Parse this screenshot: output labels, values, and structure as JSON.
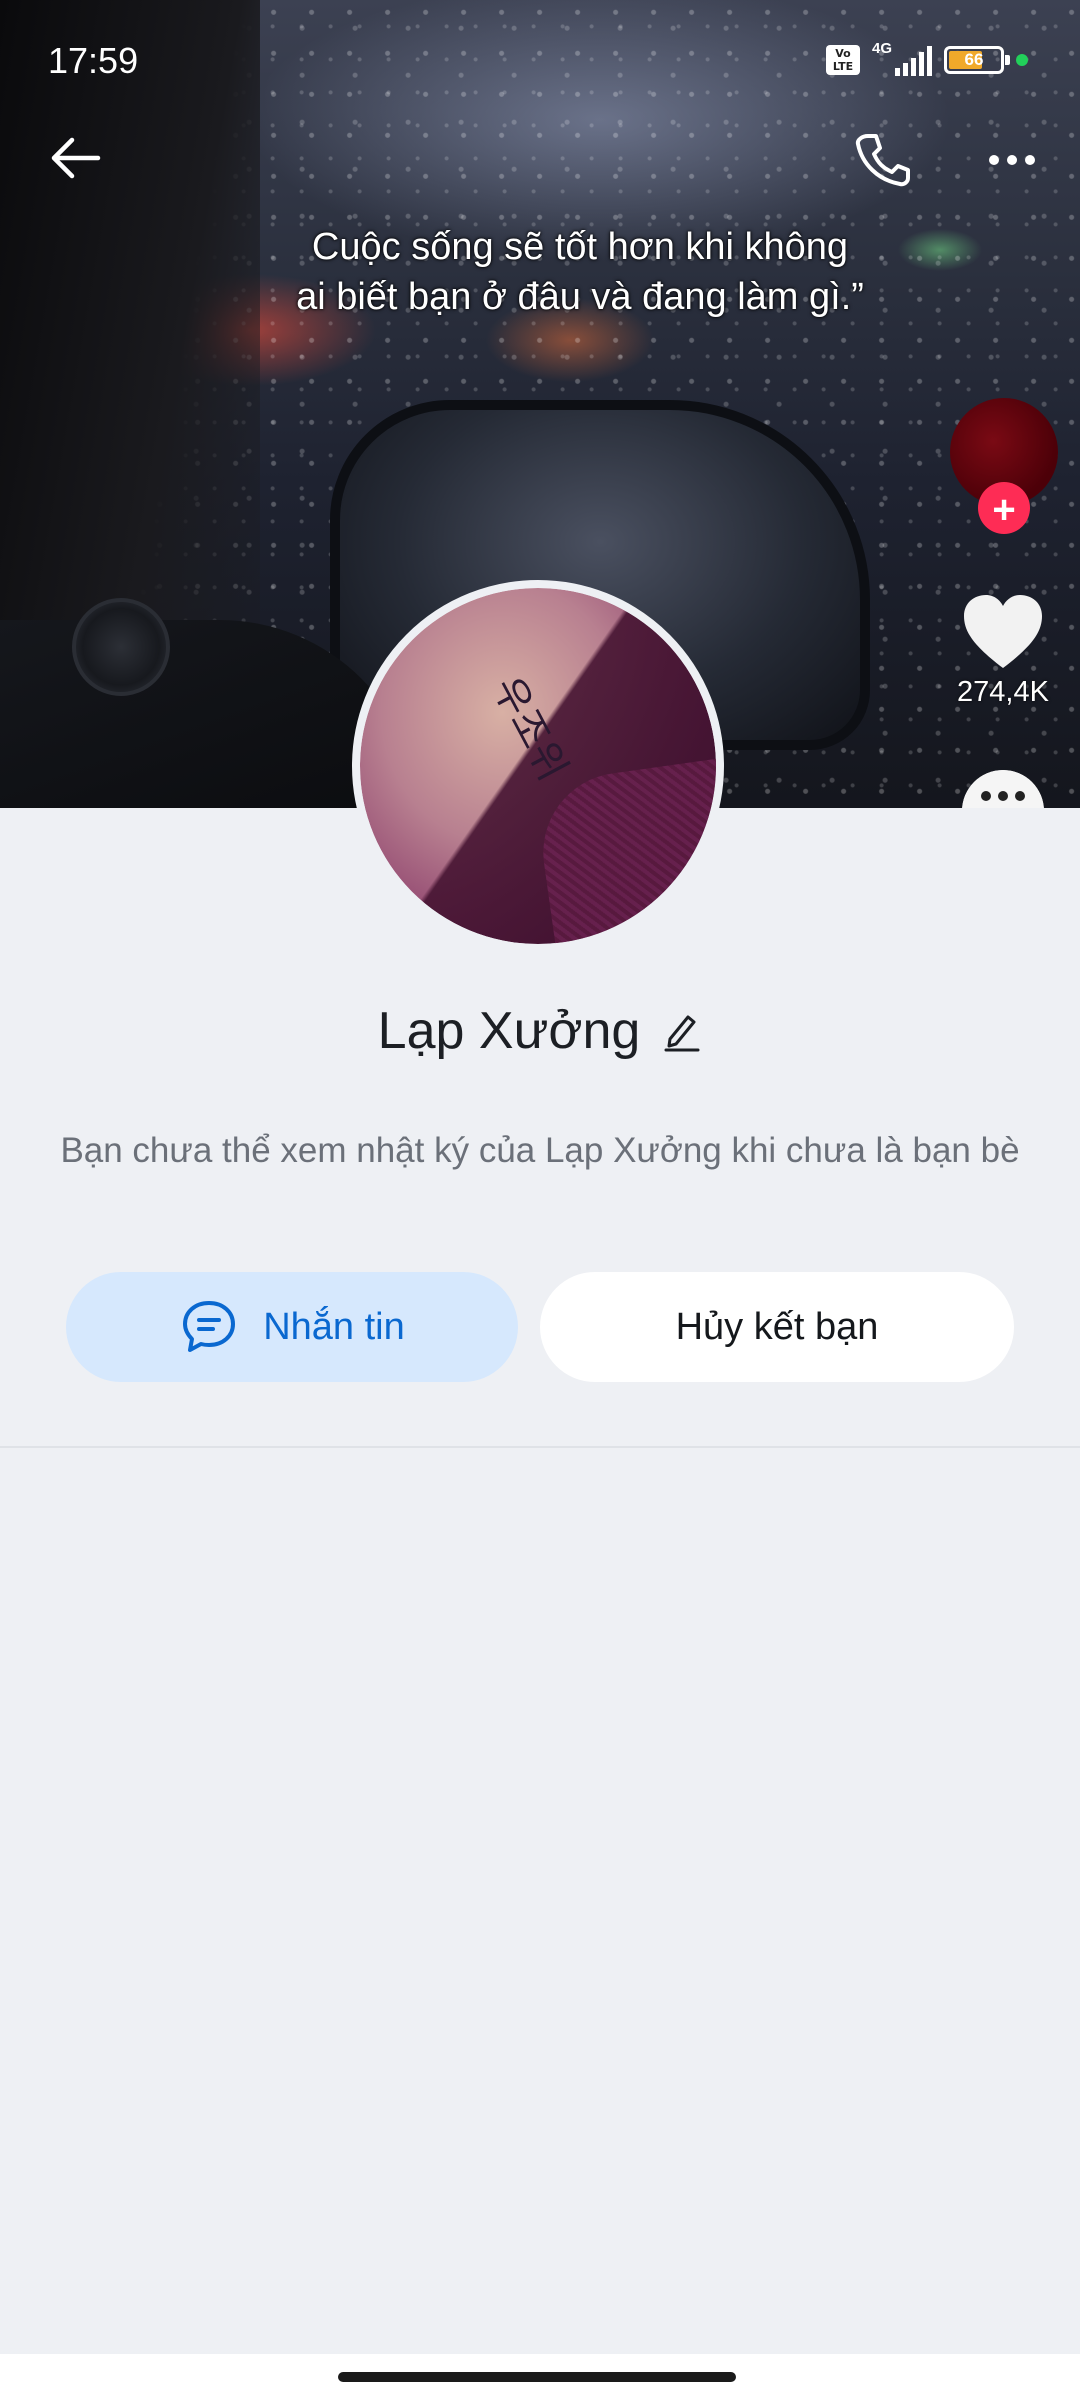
{
  "status_bar": {
    "time": "17:59",
    "volte": "Vo LTE",
    "network": "4G",
    "battery": "66",
    "battery_level": 0.66
  },
  "cover": {
    "quote": "Cuộc sống sẽ tốt hơn khi không\nai biết bạn ở đâu và đang làm gì.”",
    "like_count": "274,4K"
  },
  "header": {
    "back_icon": "arrow-left-icon",
    "call_icon": "phone-icon",
    "more_icon": "more-horizontal-icon"
  },
  "avatar": {
    "tattoo_text": "우조위"
  },
  "profile": {
    "name": "Lạp Xưởng",
    "notice": "Bạn chưa thể xem nhật ký của Lạp Xưởng khi chưa là bạn bè"
  },
  "actions": {
    "message_label": "Nhắn tin",
    "unfriend_label": "Hủy kết bạn"
  },
  "colors": {
    "accent": "#0a68d0",
    "message_bg": "#d6e8fd",
    "page_bg": "#eef0f4",
    "follow_red": "#fe2c55"
  }
}
